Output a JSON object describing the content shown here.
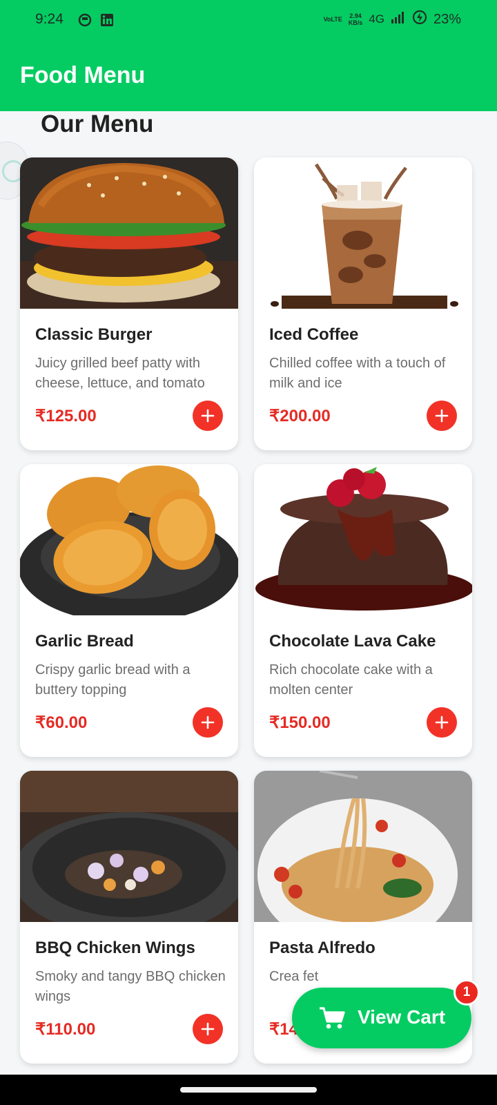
{
  "status_bar": {
    "time": "9:24",
    "net_type": "VoLTE",
    "speed_value": "2.94",
    "speed_unit": "KB/s",
    "network": "4G",
    "battery": "23%",
    "icons": [
      "notification-circle-icon",
      "linkedin-icon",
      "volte-icon",
      "signal-icon",
      "battery-charging-icon"
    ]
  },
  "app_bar": {
    "title": "Food Menu"
  },
  "section_title": "Our Menu",
  "currency_symbol": "₹",
  "items": [
    {
      "name": "Classic Burger",
      "description": "Juicy grilled beef patty with cheese, lettuce, and tomato",
      "price": "₹125.00",
      "image": "burger"
    },
    {
      "name": "Iced Coffee",
      "description": "Chilled coffee with a touch of milk and ice",
      "price": "₹200.00",
      "image": "iced-coffee"
    },
    {
      "name": "Garlic Bread",
      "description": "Crispy garlic bread with a buttery topping",
      "price": "₹60.00",
      "image": "garlic-bread"
    },
    {
      "name": "Chocolate Lava Cake",
      "description": "Rich chocolate cake with a molten center",
      "price": "₹150.00",
      "image": "lava-cake"
    },
    {
      "name": "BBQ Chicken Wings",
      "description": "Smoky and tangy BBQ chicken wings",
      "price": "₹110.00",
      "image": "chicken-wings"
    },
    {
      "name": "Pasta Alfredo",
      "description": "Crea fet",
      "price": "₹140.00",
      "image": "pasta"
    }
  ],
  "cart": {
    "label": "View Cart",
    "count": "1"
  },
  "colors": {
    "primary": "#04cc62",
    "accent": "#f23227",
    "price": "#e52b24",
    "background": "#f4f6f8"
  }
}
